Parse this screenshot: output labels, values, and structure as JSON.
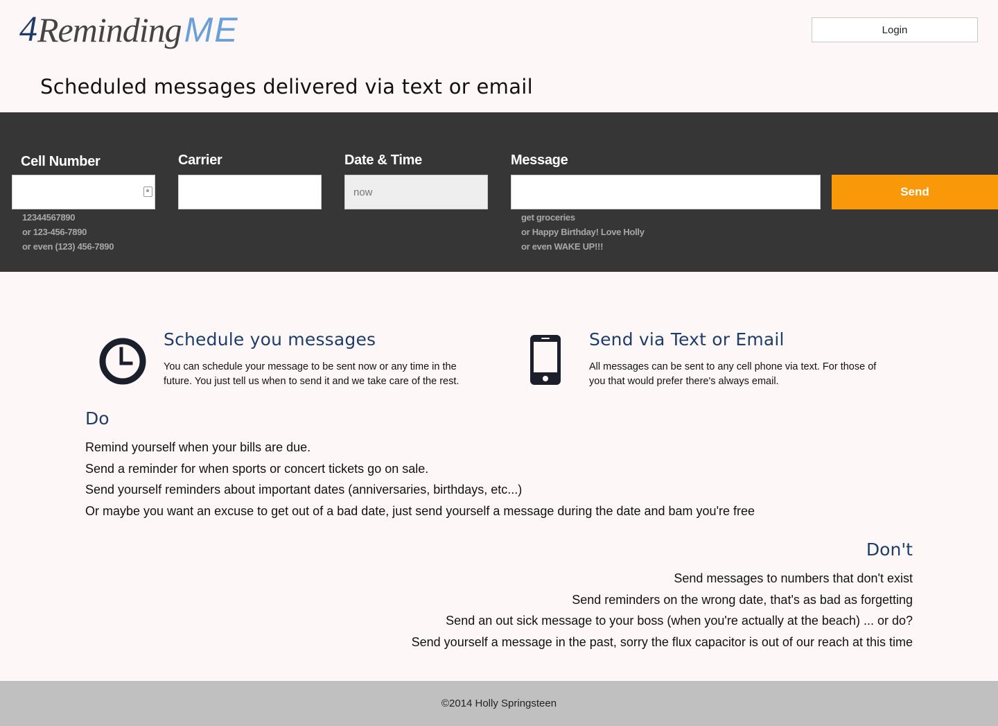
{
  "brand": {
    "part1": "4",
    "part2": "Reminding",
    "part3": "ME"
  },
  "header": {
    "login_label": "Login"
  },
  "tagline": "Scheduled messages delivered via text or email",
  "form": {
    "cell": {
      "label": "Cell Number",
      "value": "",
      "hints": [
        "12344567890",
        "or 123-456-7890",
        "or even (123) 456-7890"
      ]
    },
    "carrier": {
      "label": "Carrier",
      "value": ""
    },
    "datetime": {
      "label": "Date & Time",
      "placeholder": "now"
    },
    "message": {
      "label": "Message",
      "value": "",
      "hints": [
        "get groceries",
        "or Happy Birthday! Love Holly",
        "or even WAKE UP!!!"
      ]
    },
    "send_label": "Send"
  },
  "features": [
    {
      "icon": "clock-icon",
      "title": "Schedule you messages",
      "text": "You can schedule your message to be sent now or any time in the future. You just tell us when to send it and we take care of the rest."
    },
    {
      "icon": "phone-icon",
      "title": "Send via Text or Email",
      "text": "All messages can be sent to any cell phone via text. For those of you that would prefer there's always email."
    }
  ],
  "do": {
    "title": "Do",
    "items": [
      "Remind yourself when your bills are due.",
      "Send a reminder for when sports or concert tickets go on sale.",
      "Send yourself reminders about important dates (anniversaries, birthdays, etc...)",
      "Or maybe you want an excuse to get out of a bad date, just send yourself a message during the date and bam you're free"
    ]
  },
  "dont": {
    "title": "Don't",
    "items": [
      "Send messages to numbers that don't exist",
      "Send reminders on the wrong date, that's as bad as forgetting",
      "Send an out sick message to your boss (when you're actually at the beach) ... or do?",
      "Send yourself a message in the past, sorry the flux capacitor is out of our reach at this time"
    ]
  },
  "footer": {
    "copyright": "©2014 Holly Springsteen"
  },
  "colors": {
    "accent": "#f9990a",
    "band": "#363636",
    "heading": "#1d3e6a",
    "footer": "#c0c0c0",
    "background": "#fdf8f7"
  }
}
